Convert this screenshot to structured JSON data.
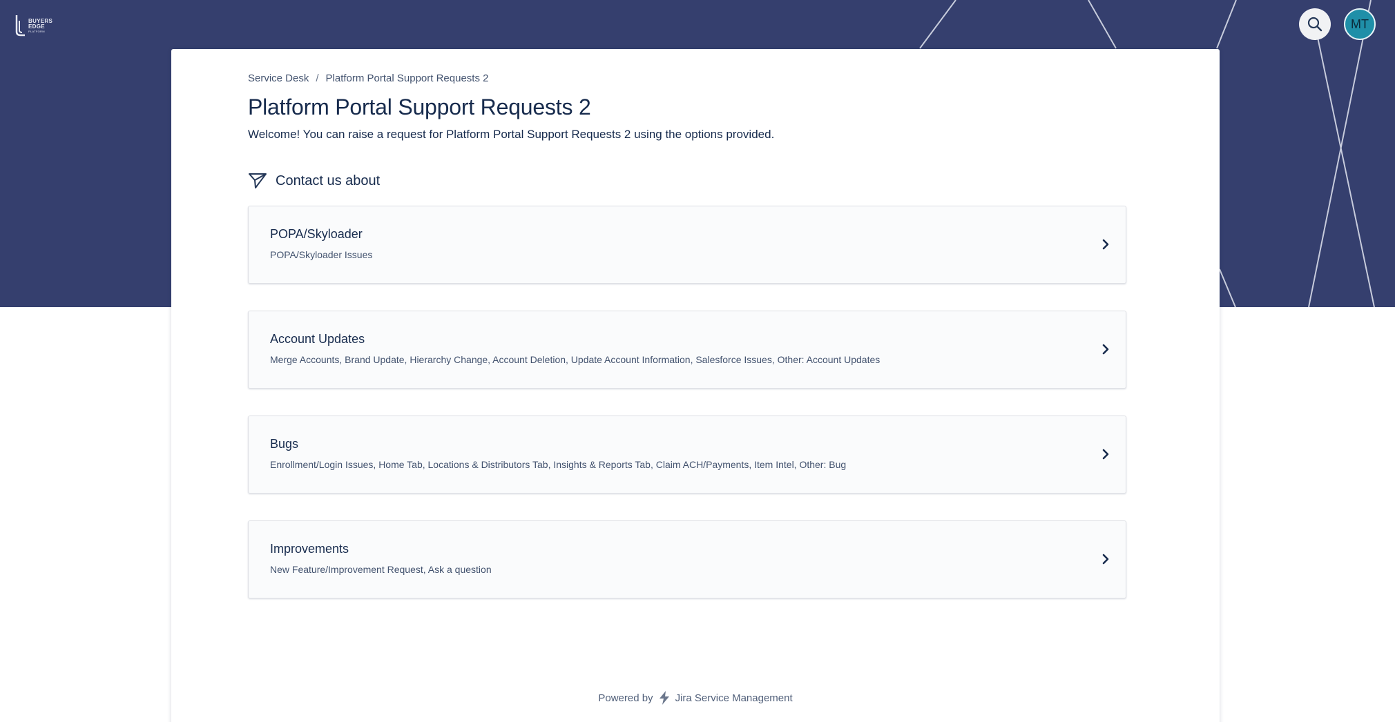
{
  "header": {
    "logo_line1": "BUYERS",
    "logo_line2": "EDGE",
    "logo_line3": "PLATFORM",
    "avatar_initials": "MT"
  },
  "breadcrumb": {
    "root": "Service Desk",
    "separator": "/",
    "current": "Platform Portal Support Requests 2"
  },
  "page": {
    "title": "Platform Portal Support Requests 2",
    "welcome": "Welcome! You can raise a request for Platform Portal Support Requests 2 using the options provided."
  },
  "section": {
    "label": "Contact us about",
    "icon": "paper-plane-icon"
  },
  "options": [
    {
      "title": "POPA/Skyloader",
      "desc": "POPA/Skyloader Issues"
    },
    {
      "title": "Account Updates",
      "desc": "Merge Accounts, Brand Update, Hierarchy Change, Account Deletion, Update Account Information, Salesforce Issues, Other: Account Updates"
    },
    {
      "title": "Bugs",
      "desc": "Enrollment/Login Issues, Home Tab, Locations & Distributors Tab, Insights & Reports Tab, Claim ACH/Payments, Item Intel, Other: Bug"
    },
    {
      "title": "Improvements",
      "desc": "New Feature/Improvement Request, Ask a question"
    }
  ],
  "footer": {
    "powered_by": "Powered by",
    "product": "Jira Service Management"
  },
  "colors": {
    "banner": "#353f6e",
    "text_primary": "#172b4d",
    "text_secondary": "#42526e",
    "avatar": "#1f8fa8"
  }
}
